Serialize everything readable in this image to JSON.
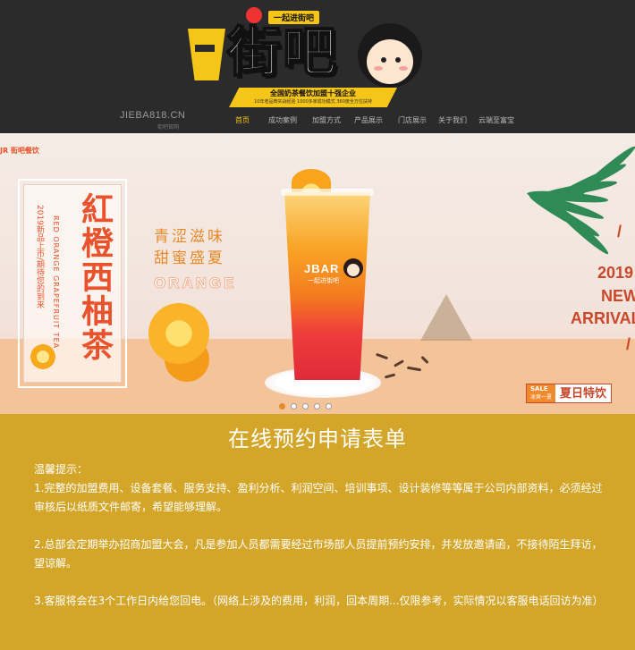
{
  "header": {
    "logo_main": "街吧",
    "logo_tag": "一起进街吧",
    "logo_banner_main": "全国奶茶餐饮加盟十强企业",
    "logo_banner_sub": "10年老品牌实战经验  1000多家成功模式  360度全方位扶持",
    "domain": "JIEBA818.CN",
    "domain_sub": "街吧官网",
    "nav": [
      "首页",
      "成功案例",
      "加盟方式",
      "产品展示",
      "门店展示",
      "关于我们",
      "云端至富宝"
    ],
    "nav_active_index": 0
  },
  "banner": {
    "brand_tag": "JR 街吧餐饮",
    "product_title": "紅橙西柚茶",
    "product_en": "RED ORANGE GRAPEFRUIT TEA",
    "product_cn": "2019新品上市/期待您的到来",
    "slogan_line1": "青涩滋味",
    "slogan_line2": "甜蜜盛夏",
    "slogan_en": "ORANGE",
    "cup_logo": "JBAR",
    "cup_logo_sub": "一起进街吧",
    "arrival_slash": "/",
    "arrival_year": "2019",
    "arrival_new": "NEW",
    "arrival_word": "ARRIVAL",
    "sale_label": "SALE",
    "sale_sub": "冰爽一夏",
    "sale_text": "夏日特饮",
    "slide_count": 5,
    "active_slide": 0
  },
  "form": {
    "title": "在线预约申请表单",
    "notice_head": "温馨提示：",
    "notices": [
      "1.完整的加盟费用、设备套餐、服务支持、盈利分析、利润空间、培训事项、设计装修等等属于公司内部资料，必须经过审核后以纸质文件邮寄，希望能够理解。",
      "2.总部会定期举办招商加盟大会，凡是参加人员都需要经过市场部人员提前预约安排，并发放邀请函，不接待陌生拜访，望谅解。",
      "3.客服将会在3个工作日内给您回电。（网络上涉及的费用，利润，回本周期...仅限参考，实际情况以客服电话回访为准）"
    ]
  },
  "colors": {
    "header_bg": "#2b2b2b",
    "brand_yellow": "#f5c518",
    "section_gold": "#d3a62a",
    "accent_orange": "#e8532d"
  }
}
